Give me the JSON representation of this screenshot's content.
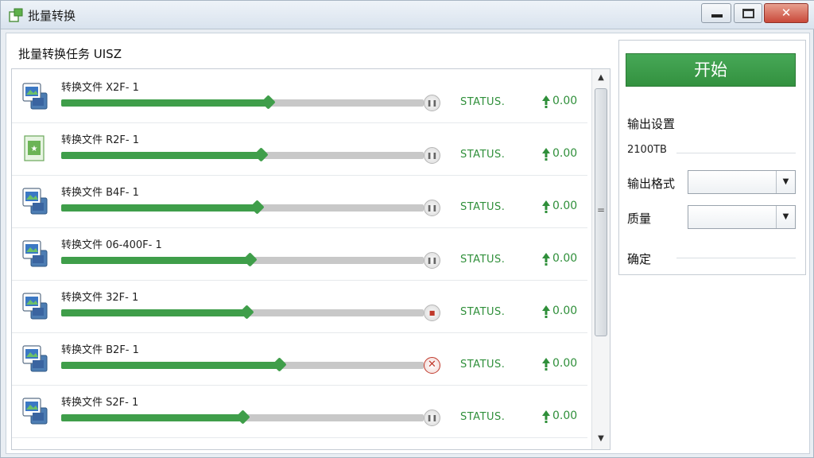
{
  "window": {
    "title": "批量转换"
  },
  "panel": {
    "title": "批量转换任务 UISZ",
    "status_text": "STATUS.",
    "items": [
      {
        "name": "转换文件 X2F- 1",
        "progress": 0.57,
        "percent": "0.00",
        "icon": "image-file-icon",
        "action": "pause"
      },
      {
        "name": "转换文件 R2F- 1",
        "progress": 0.55,
        "percent": "0.00",
        "icon": "document-file-icon",
        "action": "pause"
      },
      {
        "name": "转换文件 B4F- 1",
        "progress": 0.54,
        "percent": "0.00",
        "icon": "image-file-icon",
        "action": "pause"
      },
      {
        "name": "转换文件 06-400F- 1",
        "progress": 0.52,
        "percent": "0.00",
        "icon": "image-file-icon",
        "action": "pause"
      },
      {
        "name": "转换文件 32F- 1",
        "progress": 0.51,
        "percent": "0.00",
        "icon": "image-file-icon",
        "action": "stop"
      },
      {
        "name": "转换文件 B2F- 1",
        "progress": 0.6,
        "percent": "0.00",
        "icon": "image-file-icon",
        "action": "cancel"
      },
      {
        "name": "转换文件 S2F- 1",
        "progress": 0.5,
        "percent": "0.00",
        "icon": "image-file-icon",
        "action": "pause"
      }
    ]
  },
  "sidebar": {
    "start_label": "开始",
    "section_title": "输出设置",
    "size_value": "2100TB",
    "format_label": "输出格式",
    "format_value": "",
    "quality_label": "质量",
    "quality_value": "",
    "confirm_label": "确定"
  },
  "colors": {
    "accent": "#3f9e4a",
    "status": "#2f8f3a",
    "cancel": "#c0392b"
  }
}
